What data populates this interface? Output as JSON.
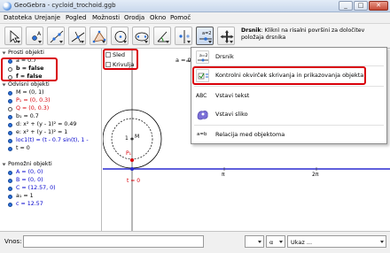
{
  "window": {
    "title": "GeoGebra - cycloid_trochoid.ggb",
    "controls": [
      "_",
      "□",
      "✕"
    ]
  },
  "menu": [
    "Datoteka",
    "Urejanje",
    "Pogled",
    "Možnosti",
    "Orodja",
    "Okno",
    "Pomoč"
  ],
  "toolbar": {
    "tools": [
      "move-tool",
      "point-tool",
      "line-tool",
      "perpendicular-tool",
      "polygon-tool",
      "circle-tool",
      "conic-tool",
      "angle-tool",
      "reflect-tool",
      "slider-tool",
      "move-view-tool"
    ],
    "selected_index": 9,
    "help_title": "Drsnik",
    "help_text": ": Kliknì na risalni površini za določitev položaja drsnika"
  },
  "algebra": {
    "free_header": "Prosti objekti",
    "free": [
      {
        "text": "a = 0.7",
        "color": "#000000",
        "on": true
      },
      {
        "text": "b = false",
        "color": "#000000",
        "on": false,
        "bold": true
      },
      {
        "text": "f = false",
        "color": "#000000",
        "on": false,
        "bold": true
      }
    ],
    "dependent_header": "Odvisni objekti",
    "dependent": [
      {
        "text": "M = (0, 1)",
        "color": "#000000",
        "on": true
      },
      {
        "text": "P₁ = (0, 0.3)",
        "color": "#d9000a",
        "on": true
      },
      {
        "text": "Q = (0, 0.3)",
        "color": "#d9000a",
        "on": false
      },
      {
        "text": "b₁ = 0.7",
        "color": "#000000",
        "on": true
      },
      {
        "text": "d: x² + (y - 1)² = 0.49",
        "color": "#000000",
        "on": true
      },
      {
        "text": "e: x² + (y - 1)² = 1",
        "color": "#000000",
        "on": true
      },
      {
        "text": "loc1(t) = (t - 0.7 sin(t), 1 -",
        "color": "#0000cc",
        "on": true
      },
      {
        "text": "t = 0",
        "color": "#000000",
        "on": true
      }
    ],
    "aux_header": "Pomožni objekti",
    "aux": [
      {
        "text": "A = (0, 0)",
        "color": "#0000cc",
        "on": true
      },
      {
        "text": "B = (0, 0)",
        "color": "#0000cc",
        "on": true
      },
      {
        "text": "C = (12.57, 0)",
        "color": "#0000cc",
        "on": true
      },
      {
        "text": "a₁ = 1",
        "color": "#000000",
        "on": true
      },
      {
        "text": "c = 12.57",
        "color": "#0000cc",
        "on": true
      }
    ]
  },
  "graphics": {
    "checkboxes": [
      {
        "label": "Sled",
        "checked": false
      },
      {
        "label": "Krivulja",
        "checked": false
      }
    ],
    "slider_label": "a = 0.",
    "point_p": "P₁",
    "point_m": "M",
    "t_label": "t = 0",
    "x_ticks": [
      "π",
      "2π"
    ],
    "y_tick": "1"
  },
  "slider_menu": [
    {
      "label": "Drsnik",
      "icon": "slider-icon",
      "highlighted": false
    },
    {
      "label": "Kontrolni okvirček skrivanja in prikazovanja objekta",
      "icon": "checkbox-tool-icon",
      "highlighted": true
    },
    {
      "label": "Vstavi tekst",
      "icon": "text-icon",
      "icon_text": "ABC",
      "highlighted": false
    },
    {
      "label": "Vstavi sliko",
      "icon": "image-icon",
      "highlighted": false
    },
    {
      "label": "Relacija med objektoma",
      "icon": "relation-icon",
      "icon_text": "a=b",
      "highlighted": false
    }
  ],
  "inputbar": {
    "label": "Vnos:",
    "value": "",
    "symbol_select": "",
    "greek_select": "α",
    "command_select": "Ukaz ..."
  },
  "colors": {
    "highlight_red": "#d9000a",
    "axis_blue": "#2a2ad0",
    "point_red": "#d9000a"
  }
}
